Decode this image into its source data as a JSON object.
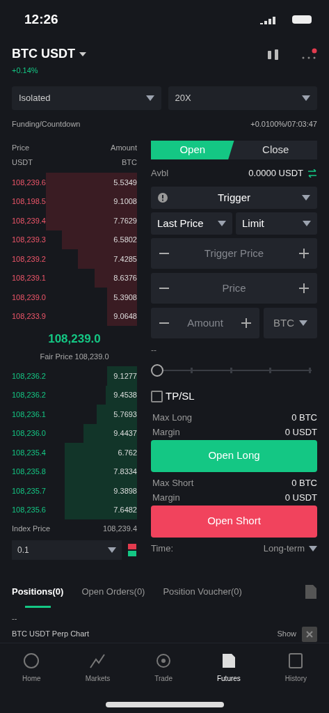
{
  "status_bar": {
    "time": "12:26"
  },
  "header": {
    "pair": "BTC USDT",
    "change": "+0.14%"
  },
  "margin_mode": {
    "value": "Isolated"
  },
  "leverage": {
    "value": "20X"
  },
  "funding": {
    "label": "Funding/Countdown",
    "value": "+0.0100%/07:03:47"
  },
  "order_book": {
    "price_header": "Price",
    "price_unit": "USDT",
    "amount_header": "Amount",
    "amount_unit": "BTC",
    "asks": [
      {
        "price": "108,239.6",
        "amount": "5.5349"
      },
      {
        "price": "108,198.5",
        "amount": "9.1008"
      },
      {
        "price": "108,239.4",
        "amount": "7.7629"
      },
      {
        "price": "108,239.3",
        "amount": "6.5802"
      },
      {
        "price": "108,239.2",
        "amount": "7.4285"
      },
      {
        "price": "108,239.1",
        "amount": "8.6376"
      },
      {
        "price": "108,239.0",
        "amount": "5.3908"
      },
      {
        "price": "108,233.9",
        "amount": "9.0648"
      }
    ],
    "last_price": "108,239.0",
    "fair_price": "Fair Price 108,239.0",
    "bids": [
      {
        "price": "108,236.2",
        "amount": "9.1277"
      },
      {
        "price": "108,236.2",
        "amount": "9.4538"
      },
      {
        "price": "108,236.1",
        "amount": "5.7693"
      },
      {
        "price": "108,236.0",
        "amount": "9.4437"
      },
      {
        "price": "108,235.4",
        "amount": "6.762"
      },
      {
        "price": "108,235.8",
        "amount": "7.8334"
      },
      {
        "price": "108,235.7",
        "amount": "9.3898"
      },
      {
        "price": "108,235.6",
        "amount": "7.6482"
      }
    ],
    "index_label": "Index Price",
    "index_value": "108,239.4",
    "depth": "0.1"
  },
  "order_form": {
    "tabs": [
      {
        "label": "Open",
        "selected": true
      },
      {
        "label": "Close",
        "selected": false
      }
    ],
    "available_label": "Avbl",
    "available_value": "0.0000 USDT",
    "order_type": "Trigger",
    "trigger_source": "Last Price",
    "execution": "Limit",
    "trigger_price": {
      "placeholder": "Trigger Price"
    },
    "price": {
      "placeholder": "Price"
    },
    "amount": {
      "placeholder": "Amount"
    },
    "amount_unit": "BTC",
    "slider_value": "--",
    "slider": {
      "level": 0
    },
    "tpsl": {
      "label": "TP/SL",
      "checked": false
    },
    "long": [
      {
        "label": "Max Long",
        "value": "0 BTC"
      },
      {
        "label": "Margin",
        "value": "0 USDT"
      }
    ],
    "long_button": "Open Long",
    "short": [
      {
        "label": "Max Short",
        "value": "0 BTC"
      },
      {
        "label": "Margin",
        "value": "0 USDT"
      }
    ],
    "short_button": "Open Short",
    "time_label": "Time:",
    "time_value": "Long-term"
  },
  "bottom_tabs": [
    {
      "label": "Positions(0)",
      "selected": true
    },
    {
      "label": "Open Orders(0)",
      "selected": false
    },
    {
      "label": "Position Voucher(0)",
      "selected": false
    }
  ],
  "positions_placeholder": "--",
  "chart_row": {
    "label": "BTC USDT Perp Chart",
    "action": "Show"
  },
  "nav": [
    {
      "label": "Home",
      "selected": false
    },
    {
      "label": "Markets",
      "selected": false
    },
    {
      "label": "Trade",
      "selected": false
    },
    {
      "label": "Futures",
      "selected": true
    },
    {
      "label": "History",
      "selected": false
    }
  ]
}
